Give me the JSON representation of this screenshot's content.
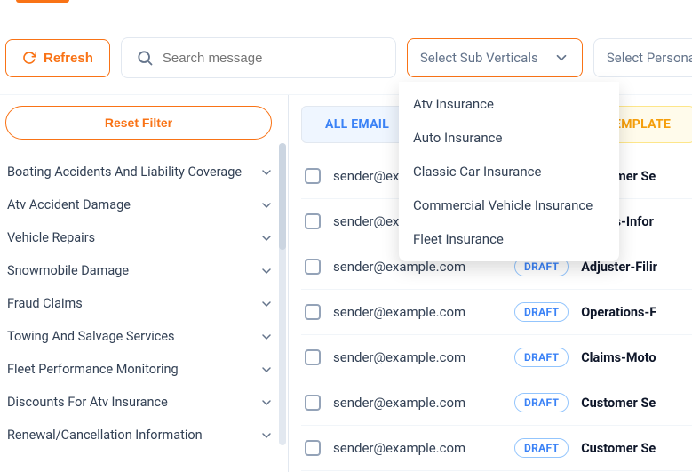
{
  "toolbar": {
    "refresh_label": "Refresh",
    "search_placeholder": "Search message",
    "sub_verticals_placeholder": "Select Sub Verticals",
    "persona_placeholder": "Select Persona"
  },
  "sidebar": {
    "reset_label": "Reset Filter",
    "filters": [
      "Boating Accidents And Liability Coverage",
      "Atv Accident Damage",
      "Vehicle Repairs",
      "Snowmobile Damage",
      "Fraud Claims",
      "Towing And Salvage Services",
      "Fleet Performance Monitoring",
      "Discounts For Atv Insurance",
      "Renewal/Cancellation Information"
    ]
  },
  "tabs": {
    "all": "ALL EMAIL",
    "template": "TEMPLATE"
  },
  "dropdown": {
    "items": [
      "Atv Insurance",
      "Auto Insurance",
      "Classic Car Insurance",
      "Commercial Vehicle Insurance",
      "Fleet Insurance"
    ]
  },
  "status": {
    "draft": "DRAFT"
  },
  "rows": [
    {
      "email": "sender@example.com",
      "subject": "Customer Se"
    },
    {
      "email": "sender@example.com",
      "subject": "Claims-Infor"
    },
    {
      "email": "sender@example.com",
      "subject": "Adjuster-Filir"
    },
    {
      "email": "sender@example.com",
      "subject": "Operations-F"
    },
    {
      "email": "sender@example.com",
      "subject": "Claims-Moto"
    },
    {
      "email": "sender@example.com",
      "subject": "Customer Se"
    },
    {
      "email": "sender@example.com",
      "subject": "Customer Se"
    }
  ]
}
